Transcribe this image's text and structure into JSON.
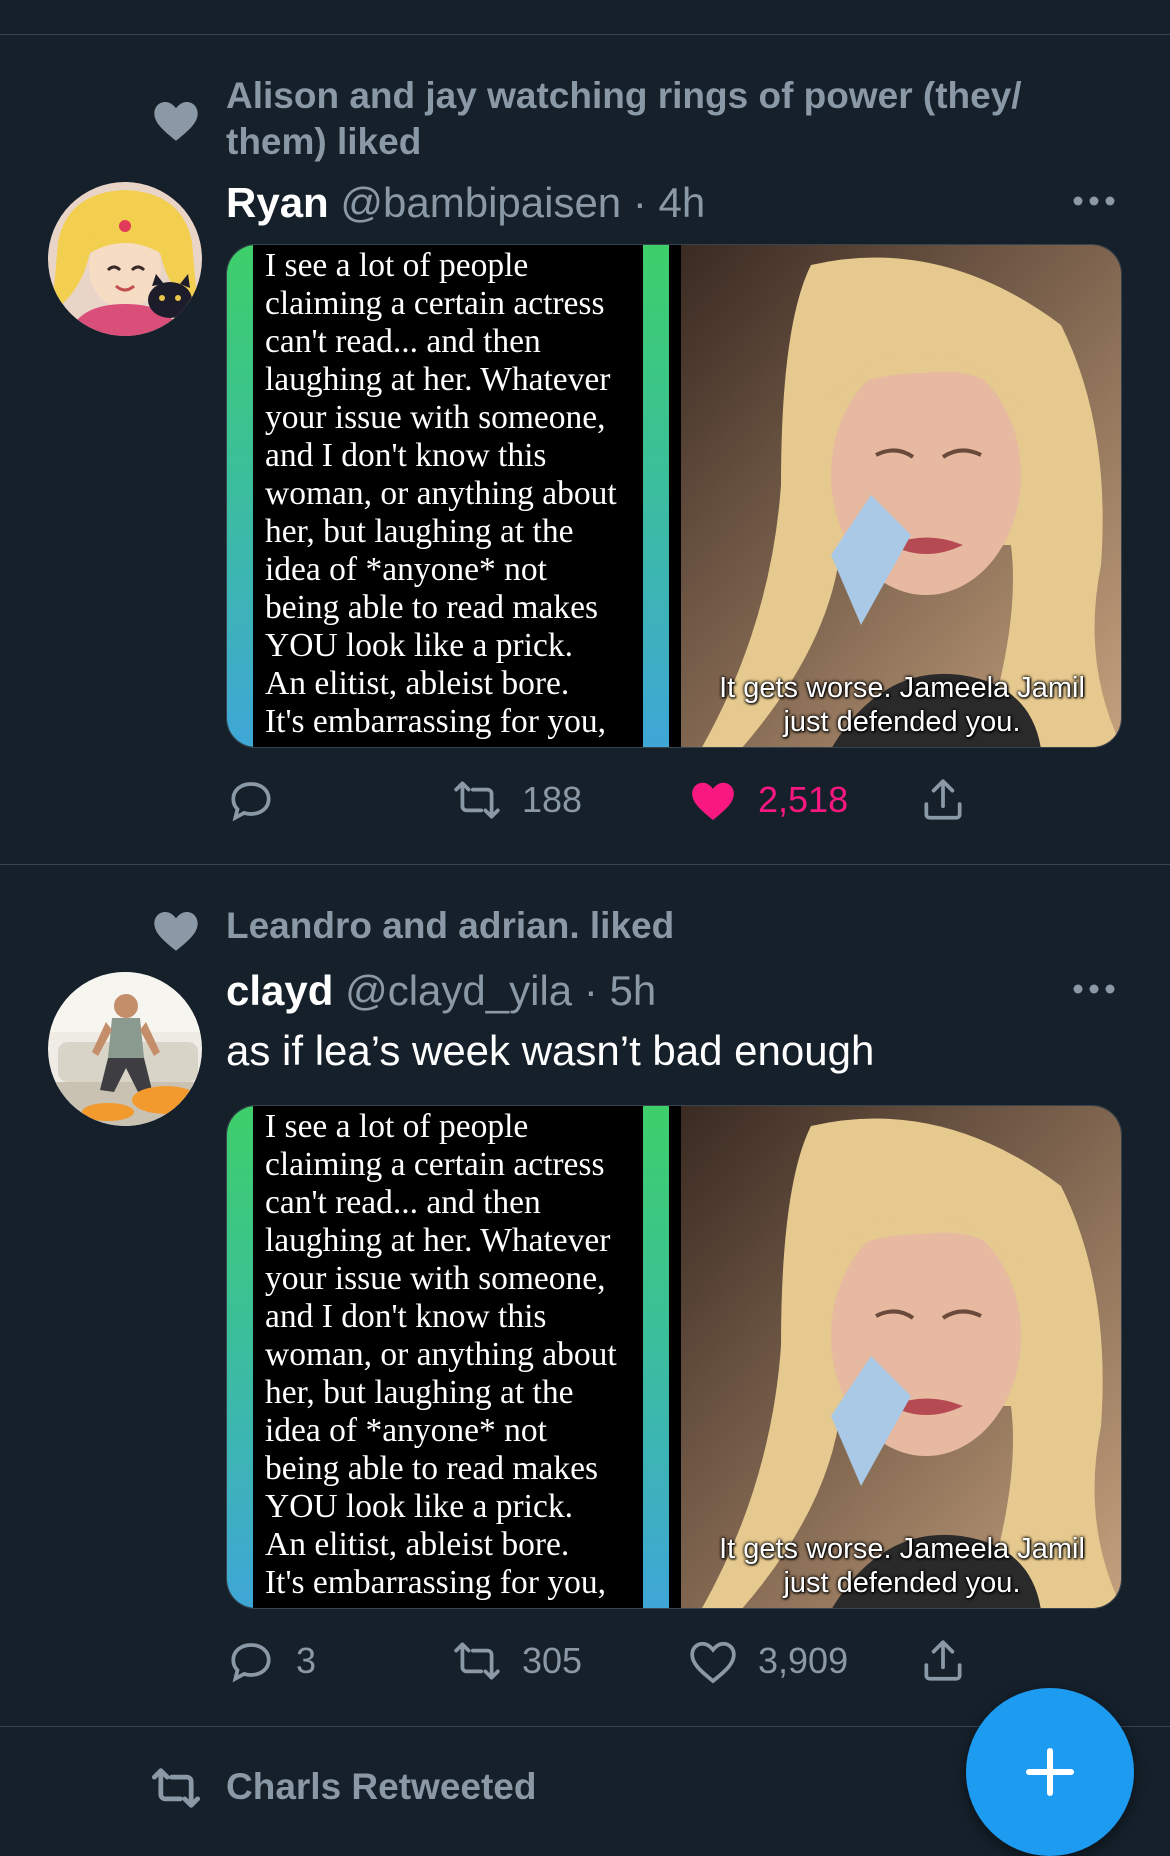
{
  "colors": {
    "background": "#15202b",
    "divider": "#38444d",
    "secondary_text": "#8b98a5",
    "like_pink": "#f91880",
    "accent_blue": "#1d9bf0"
  },
  "timeline": [
    {
      "context": "Alison and jay watching rings of power (they/ them) liked",
      "context_icon": "heart-icon",
      "display_name": "Ryan",
      "handle": "@bambipaisen",
      "separator": "·",
      "time": "4h",
      "text": "",
      "media": {
        "left_text_lines": [
          "I see a lot of people",
          "claiming a certain actress",
          "can't read... and then",
          "laughing at her. Whatever",
          "your issue with someone,",
          "and I don't know this",
          "woman, or anything about",
          "her, but laughing at the",
          "idea of *anyone* not",
          "being able to read makes",
          "YOU look like a prick.",
          "An elitist, ableist bore.",
          "It's embarrassing for you,"
        ],
        "caption_line1": "It gets worse. Jameela Jamil",
        "caption_line2": "just defended you."
      },
      "actions": {
        "replies": "",
        "retweets": "188",
        "likes": "2,518",
        "liked": true
      }
    },
    {
      "context": "Leandro and adrian. liked",
      "context_icon": "heart-icon",
      "display_name": "clayd",
      "handle": "@clayd_yila",
      "separator": "·",
      "time": "5h",
      "text": "as if lea’s week wasn’t bad enough",
      "media": {
        "left_text_lines": [
          "I see a lot of people",
          "claiming a certain actress",
          "can't read... and then",
          "laughing at her. Whatever",
          "your issue with someone,",
          "and I don't know this",
          "woman, or anything about",
          "her, but laughing at the",
          "idea of *anyone* not",
          "being able to read makes",
          "YOU look like a prick.",
          "An elitist, ableist bore.",
          "It's embarrassing for you,"
        ],
        "caption_line1": "It gets worse. Jameela Jamil",
        "caption_line2": "just defended you."
      },
      "actions": {
        "replies": "3",
        "retweets": "305",
        "likes": "3,909",
        "liked": false
      }
    }
  ],
  "next_context": {
    "context": "Charls Retweeted",
    "context_icon": "retweet-icon"
  },
  "fab": {
    "icon": "plus-icon"
  }
}
